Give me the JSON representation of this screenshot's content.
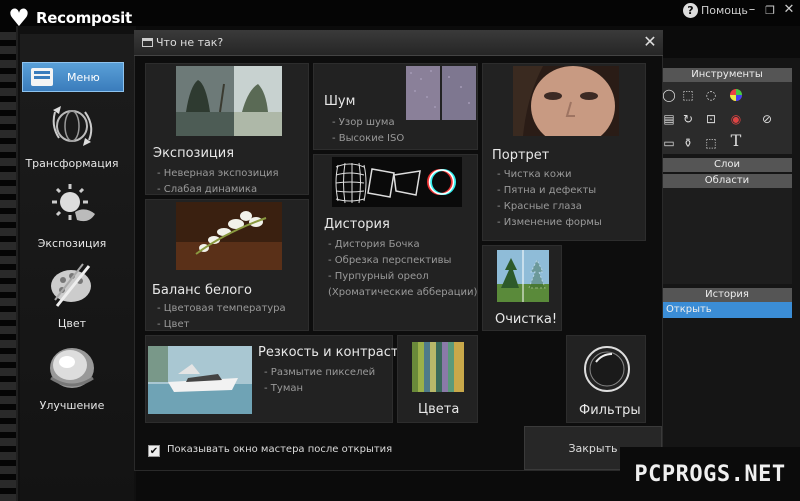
{
  "app": {
    "logo_text": "Recomposit"
  },
  "titlebar": {
    "help_label": "Помощь",
    "minimize": "–",
    "restore": "❐",
    "close": "✕"
  },
  "sidebar": {
    "menu_label": "Меню",
    "items": [
      {
        "label": "Трансформация",
        "icon": "transform-icon"
      },
      {
        "label": "Экспозиция",
        "icon": "exposure-icon"
      },
      {
        "label": "Цвет",
        "icon": "palette-icon"
      },
      {
        "label": "Улучшение",
        "icon": "enhance-icon"
      }
    ]
  },
  "right_panel": {
    "tools_header": "Инструменты",
    "layers_header": "Слои",
    "regions_header": "Области",
    "history_header": "История",
    "history_items": [
      "Открыть"
    ],
    "text_tool": "T"
  },
  "dialog": {
    "title": "Что не так?",
    "close_glyph": "✕",
    "tiles": {
      "exposure": {
        "title": "Экспозиция",
        "items": [
          "- Неверная экспозиция",
          "- Слабая динамика"
        ]
      },
      "noise": {
        "title": "Шум",
        "items": [
          "- Узор шума",
          "- Высокие ISO"
        ]
      },
      "portrait": {
        "title": "Портрет",
        "items": [
          "- Чистка кожи",
          "- Пятна и дефекты",
          "- Красные глаза",
          "- Изменение формы"
        ]
      },
      "white_balance": {
        "title": "Баланс белого",
        "items": [
          "- Цветовая температура",
          "- Цвет"
        ]
      },
      "distortion": {
        "title": "Дистория",
        "items": [
          "- Дистория Бочка",
          "- Обрезка перспективы",
          "- Пурпурный ореол",
          "(Хроматические абберации)"
        ]
      },
      "cleanup": {
        "title": "Очистка!"
      },
      "sharpness": {
        "title": "Резкость и контраст",
        "items": [
          "- Размытие пикселей",
          "- Туман"
        ]
      },
      "colors": {
        "title": "Цвета"
      },
      "filters": {
        "title": "Фильтры"
      }
    },
    "show_wizard_checked": true,
    "show_wizard_label": "Показывать окно мастера после открытия",
    "close_button": "Закрыть",
    "checkbox_glyph": "✔"
  },
  "watermark": "PCPROGS.NET",
  "colors": {
    "accent": "#3b8dd6",
    "menu_active": "#4a8fcc",
    "dialog_bg": "#0d0d0d",
    "tile_bg": "#222222"
  }
}
